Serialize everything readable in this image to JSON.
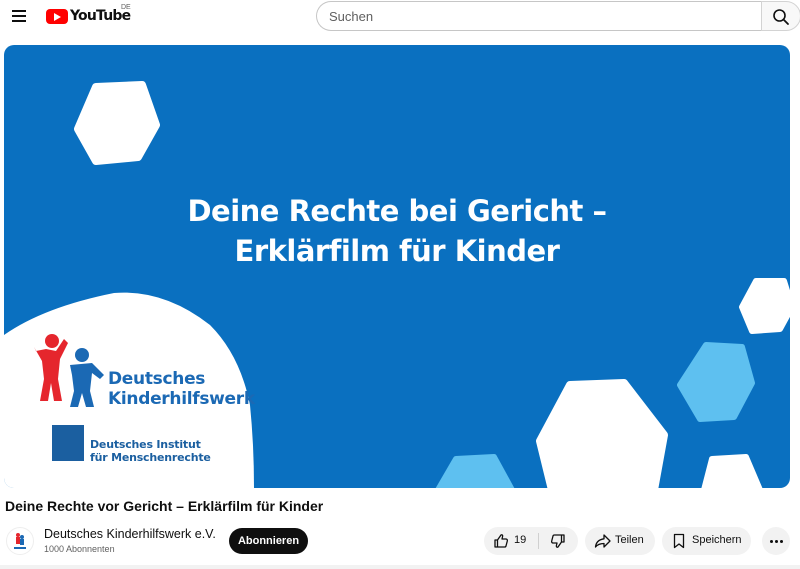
{
  "header": {
    "logo_text": "YouTube",
    "country_code": "DE",
    "search_placeholder": "Suchen"
  },
  "player": {
    "overlay_title_line1": "Deine Rechte bei Gericht –",
    "overlay_title_line2": "Erklärfilm für Kinder",
    "org1_line1": "Deutsches",
    "org1_line2": "Kinderhilfswerk",
    "org2_line1": "Deutsches Institut",
    "org2_line2": "für Menschenrechte",
    "background_color": "#0a70c0"
  },
  "video": {
    "title": "Deine Rechte vor Gericht – Erklärfilm für Kinder"
  },
  "channel": {
    "name": "Deutsches Kinderhilfswerk e.V.",
    "subscribers": "1000 Abonnenten",
    "subscribe_label": "Abonnieren"
  },
  "actions": {
    "like_count": "19",
    "share_label": "Teilen",
    "save_label": "Speichern"
  },
  "icons": {
    "menu": "hamburger-menu-icon",
    "search": "search-icon",
    "like": "thumbs-up-icon",
    "dislike": "thumbs-down-icon",
    "share": "share-arrow-icon",
    "save": "bookmark-icon",
    "more": "more-horizontal-icon"
  },
  "colors": {
    "brand_red": "#ff0000",
    "subscribe_bg": "#0f0f0f",
    "logo_blue": "#1b69b4",
    "logo_red": "#e5262d"
  }
}
